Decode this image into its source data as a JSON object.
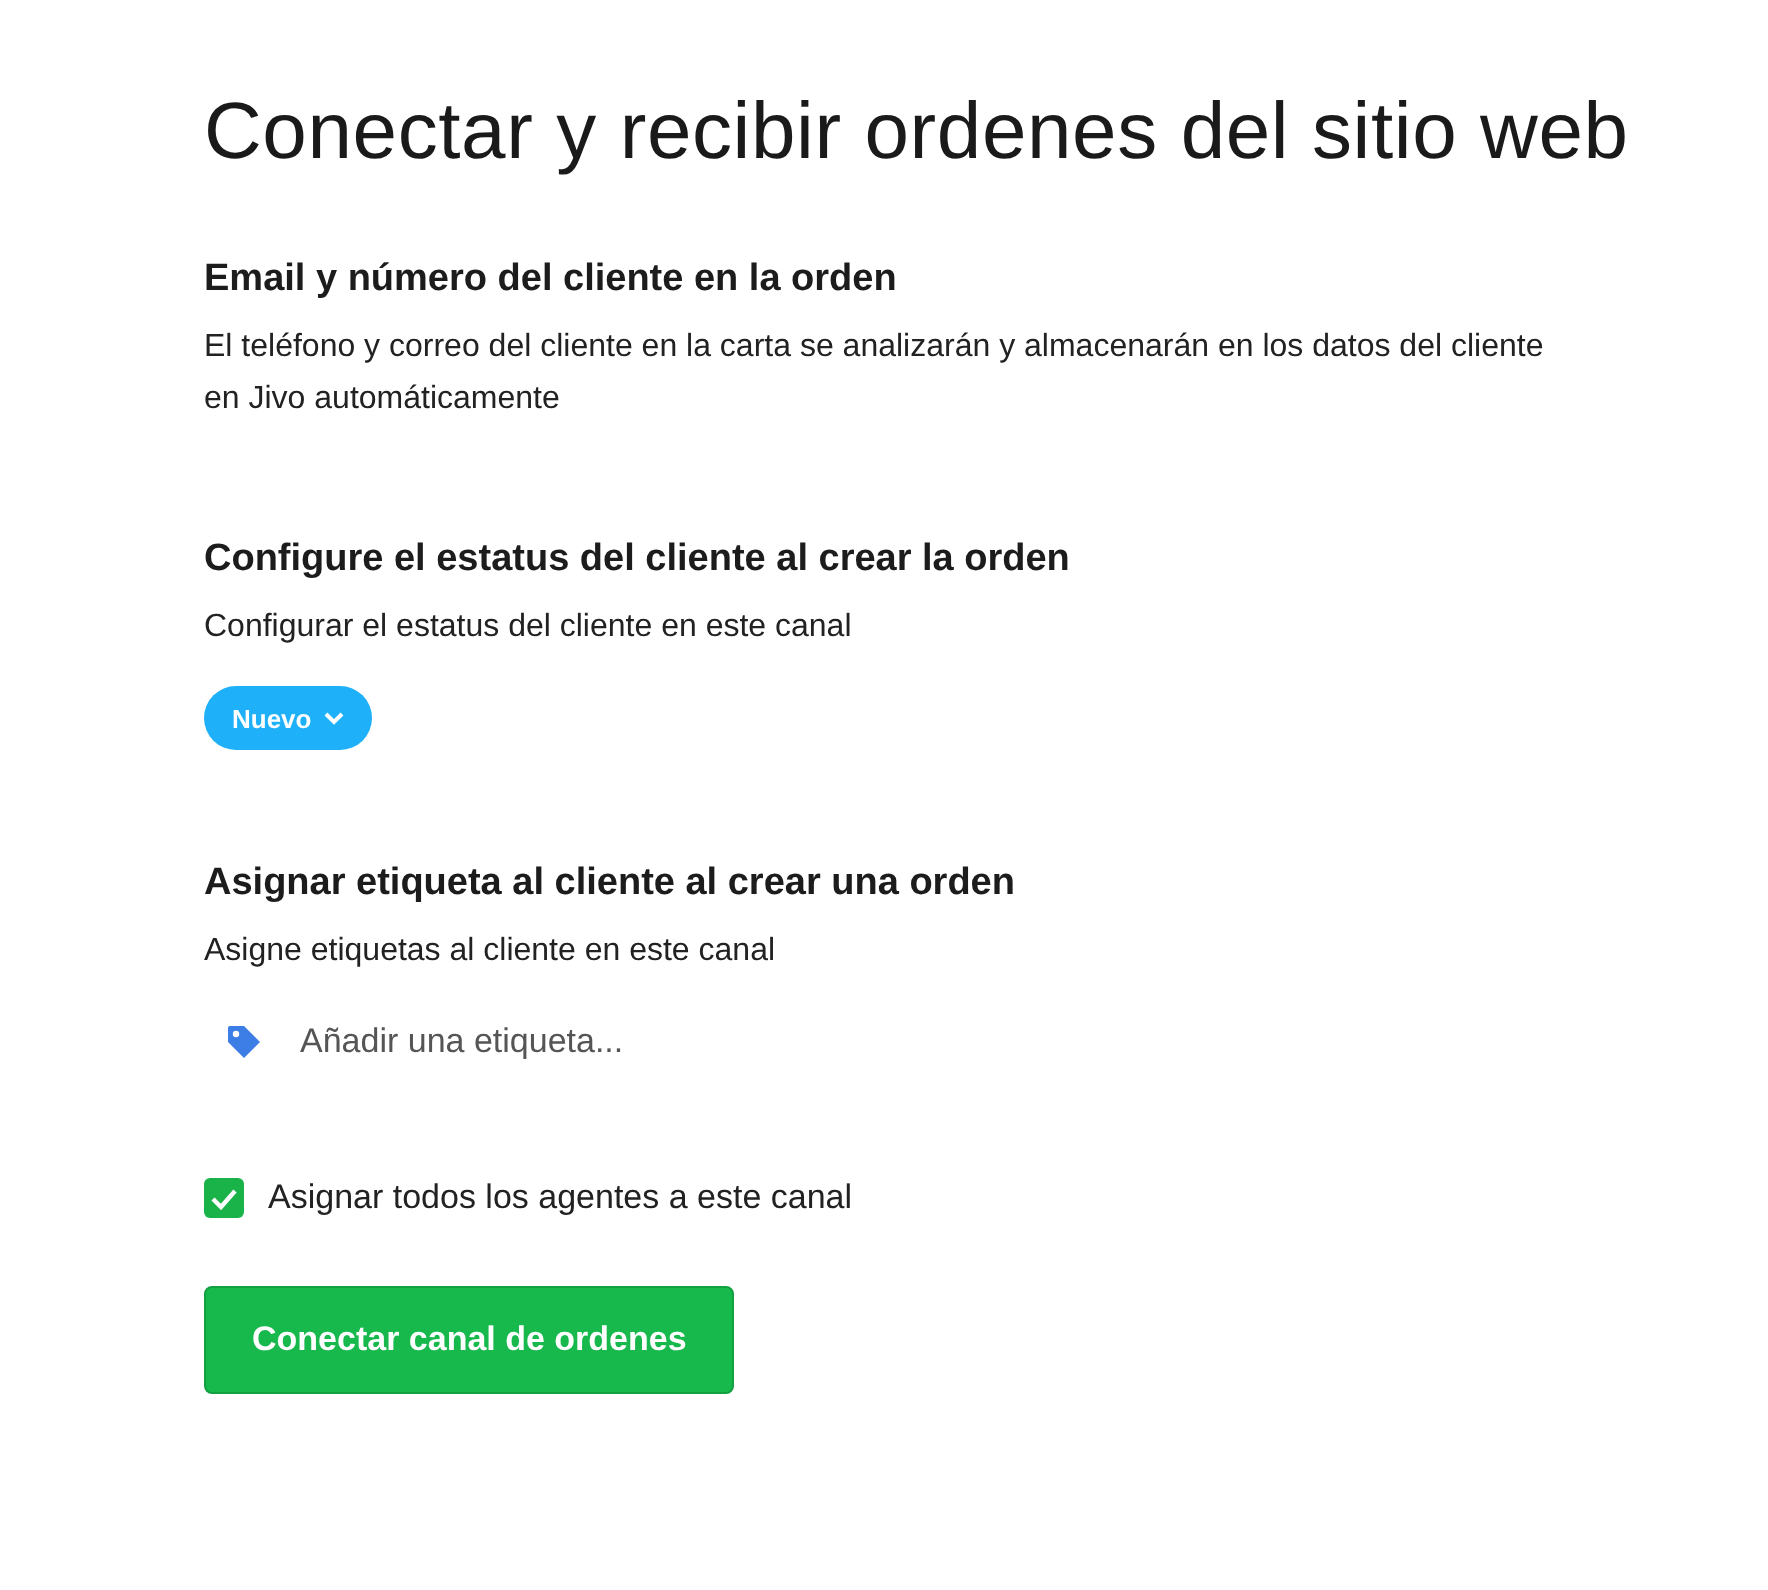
{
  "title": "Conectar y recibir ordenes del sitio web",
  "sections": [
    {
      "kind": "text",
      "heading": "Email y número del cliente en la orden",
      "description": "El teléfono y correo del cliente en la carta se analizarán y almacenarán en los datos del cliente en Jivo automáticamente"
    },
    {
      "kind": "status",
      "heading": "Configure el estatus del cliente al crear la orden",
      "description": "Configurar el estatus del cliente en este canal",
      "status": "Nuevo",
      "color": "#1eb0f9"
    },
    {
      "kind": "tags",
      "heading": "Asignar etiqueta al cliente al crear una orden",
      "description": "Asigne etiquetas al cliente en este canal",
      "placeholder": "Añadir una etiqueta..."
    }
  ],
  "assign_all": {
    "label": "Asignar todos los agentes a este canal",
    "checked": true
  },
  "submit": {
    "label": "Conectar canal de ordenes"
  }
}
